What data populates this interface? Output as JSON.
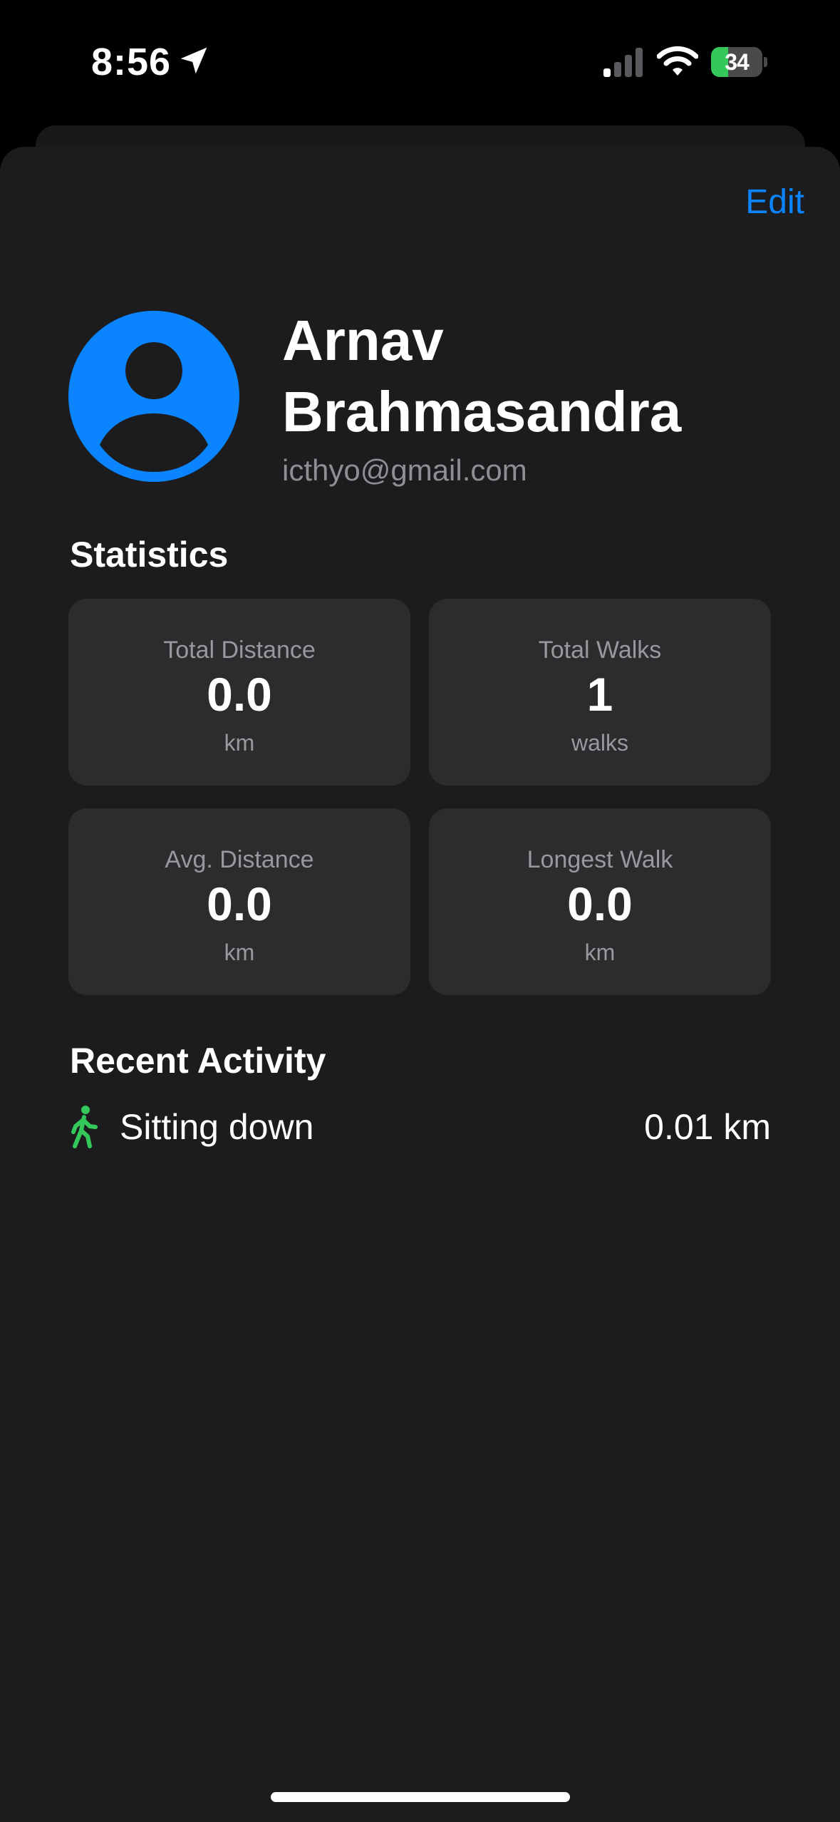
{
  "status_bar": {
    "time": "8:56",
    "battery_level": "34",
    "battery_fraction": 0.34,
    "signal_bars_active": 1,
    "signal_bars_total": 4
  },
  "colors": {
    "accent": "#0a84ff",
    "activity_green": "#34c759",
    "sheet_background": "#1c1c1e",
    "card_background": "#2c2c2e"
  },
  "header": {
    "edit_label": "Edit"
  },
  "profile": {
    "name": "Arnav Brahmasandra",
    "email": "icthyo@gmail.com",
    "avatar_icon": "person-circle-icon"
  },
  "statistics": {
    "title": "Statistics",
    "cards": [
      {
        "label": "Total Distance",
        "value": "0.0",
        "unit": "km"
      },
      {
        "label": "Total Walks",
        "value": "1",
        "unit": "walks"
      },
      {
        "label": "Avg. Distance",
        "value": "0.0",
        "unit": "km"
      },
      {
        "label": "Longest Walk",
        "value": "0.0",
        "unit": "km"
      }
    ]
  },
  "recent_activity": {
    "title": "Recent Activity",
    "items": [
      {
        "icon": "walking-figure-icon",
        "name": "Sitting down",
        "distance": "0.01 km"
      }
    ]
  }
}
